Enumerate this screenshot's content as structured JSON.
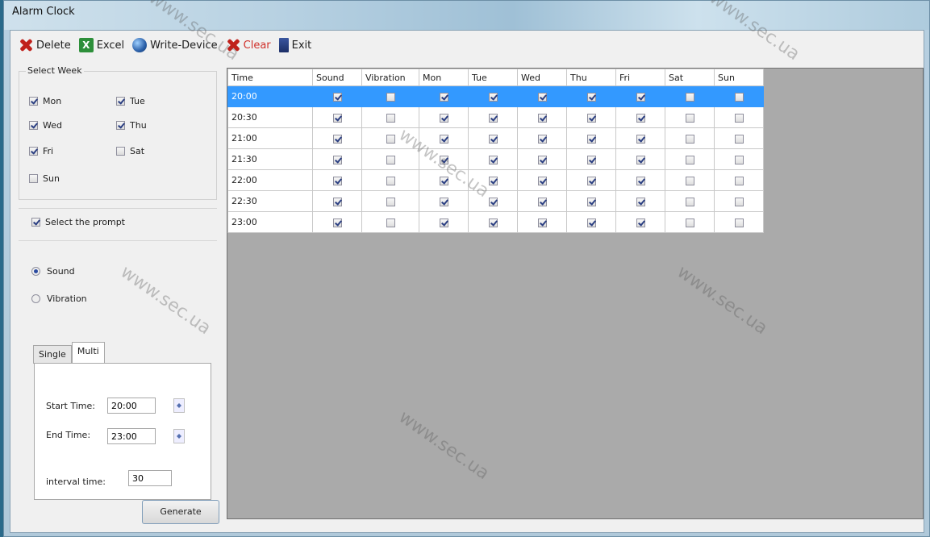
{
  "window": {
    "title": "Alarm Clock"
  },
  "toolbar": {
    "items": [
      {
        "label": "Delete",
        "icon": "delete-icon"
      },
      {
        "label": "Excel",
        "icon": "excel-icon"
      },
      {
        "label": "Write-Device",
        "icon": "device-icon"
      },
      {
        "label": "Clear",
        "icon": "clear-icon"
      },
      {
        "label": "Exit",
        "icon": "exit-icon"
      }
    ]
  },
  "select_week": {
    "title": "Select Week",
    "days": [
      {
        "label": "Mon",
        "checked": true
      },
      {
        "label": "Tue",
        "checked": true
      },
      {
        "label": "Wed",
        "checked": true
      },
      {
        "label": "Thu",
        "checked": true
      },
      {
        "label": "Fri",
        "checked": true
      },
      {
        "label": "Sat",
        "checked": false
      },
      {
        "label": "Sun",
        "checked": false
      }
    ]
  },
  "prompts": {
    "label": "Select the prompt",
    "checked": true
  },
  "mode": {
    "sound": "Sound",
    "vibration": "Vibration",
    "selected": "Sound"
  },
  "tabs": {
    "single": "Single",
    "multi": "Multi",
    "active": "Multi"
  },
  "multi": {
    "start_label": "Start Time:",
    "start_value": "20:00",
    "end_label": "End Time:",
    "end_value": "23:00",
    "interval_label": "interval time:",
    "interval_value": "30"
  },
  "generate_label": "Generate",
  "grid": {
    "columns": [
      "Time",
      "Sound",
      "Vibration",
      "Mon",
      "Tue",
      "Wed",
      "Thu",
      "Fri",
      "Sat",
      "Sun"
    ],
    "rows": [
      {
        "time": "20:00",
        "values": [
          true,
          false,
          true,
          true,
          true,
          true,
          true,
          false,
          false
        ]
      },
      {
        "time": "20:30",
        "values": [
          true,
          false,
          true,
          true,
          true,
          true,
          true,
          false,
          false
        ]
      },
      {
        "time": "21:00",
        "values": [
          true,
          false,
          true,
          true,
          true,
          true,
          true,
          false,
          false
        ]
      },
      {
        "time": "21:30",
        "values": [
          true,
          false,
          true,
          true,
          true,
          true,
          true,
          false,
          false
        ]
      },
      {
        "time": "22:00",
        "values": [
          true,
          false,
          true,
          true,
          true,
          true,
          true,
          false,
          false
        ]
      },
      {
        "time": "22:30",
        "values": [
          true,
          false,
          true,
          true,
          true,
          true,
          true,
          false,
          false
        ]
      },
      {
        "time": "23:00",
        "values": [
          true,
          false,
          true,
          true,
          true,
          true,
          true,
          false,
          false
        ]
      }
    ],
    "selected_row": 0
  },
  "watermark": "www.sec.ua"
}
